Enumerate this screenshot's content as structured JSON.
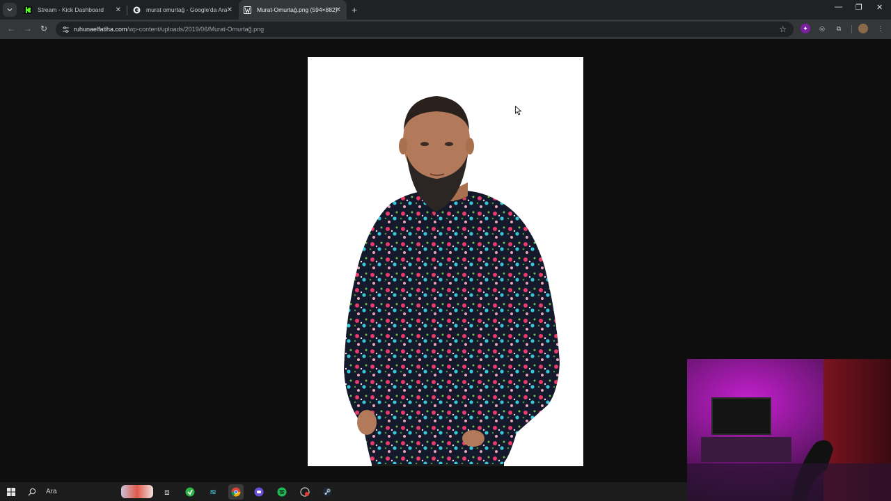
{
  "tabs": [
    {
      "title": "Stream - Kick Dashboard",
      "icon": "kick-icon"
    },
    {
      "title": "murat omurtağ - Google'da Ara",
      "icon": "google-icon"
    },
    {
      "title": "Murat-Omurtağ.png (594×882)",
      "icon": "image-icon"
    }
  ],
  "address": {
    "domain": "ruhunaelfatiha.com",
    "path": "/wp-content/uploads/2019/06/Murat-Omurtağ.png"
  },
  "taskbar": {
    "search_label": "Ara"
  },
  "colors": {
    "page_bg": "#0e0e0e",
    "tabstrip_bg": "#202124",
    "toolbar_bg": "#35363a",
    "kick_green": "#53fc18",
    "webcam_glow": "#c61fd0"
  }
}
